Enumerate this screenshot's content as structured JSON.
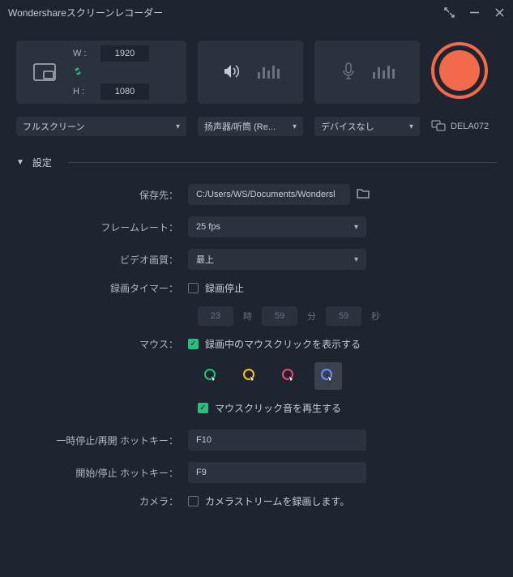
{
  "titlebar": {
    "title": "Wondershareスクリーンレコーダー"
  },
  "dimensions": {
    "w_label": "W :",
    "w_value": "1920",
    "h_label": "H :",
    "h_value": "1080"
  },
  "selects": {
    "screen_mode": "フルスクリーン",
    "system_audio": "扬声器/听筒 (Re...",
    "mic": "デバイスなし"
  },
  "device_name": "DELA072",
  "settings_header": "設定",
  "form": {
    "save_to_label": "保存先：",
    "save_to_value": "C:/Users/WS/Documents/Wondersl",
    "framerate_label": "フレームレート：",
    "framerate_value": "25 fps",
    "quality_label": "ビデオ画質：",
    "quality_value": "最上",
    "timer_label": "録画タイマー：",
    "timer_stop_label": "録画停止",
    "timer_h": "23",
    "timer_h_unit": "時",
    "timer_m": "59",
    "timer_m_unit": "分",
    "timer_s": "59",
    "timer_s_unit": "秒",
    "mouse_label": "マウス：",
    "mouse_show_clicks": "録画中のマウスクリックを表示する",
    "mouse_click_sound": "マウスクリック音を再生する",
    "pause_hotkey_label": "一時停止/再開 ホットキー：",
    "pause_hotkey_value": "F10",
    "start_hotkey_label": "開始/停止 ホットキー：",
    "start_hotkey_value": "F9",
    "camera_label": "カメラ：",
    "camera_record_label": "カメラストリームを録画します。"
  },
  "click_colors": [
    "#2dbd7e",
    "#f5c518",
    "#e74c6f",
    "#6a8cff"
  ]
}
